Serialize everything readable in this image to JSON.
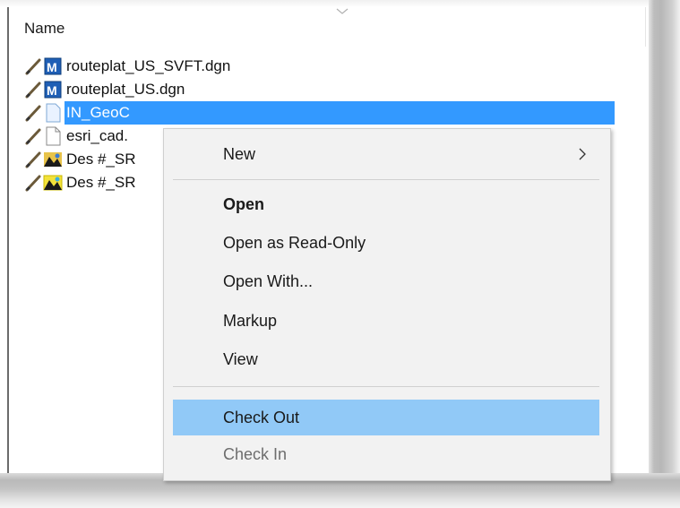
{
  "header": {
    "name_column": "Name"
  },
  "files": [
    {
      "name": "routeplat_US_SVFT.dgn",
      "icon": "microstation-dgn-icon"
    },
    {
      "name": "routeplat_US.dgn",
      "icon": "microstation-dgn-icon"
    },
    {
      "name": "IN_GeoC",
      "icon": "blank-file-icon",
      "selected": true
    },
    {
      "name": "esri_cad.",
      "icon": "document-file-icon"
    },
    {
      "name": "Des #_SR",
      "icon": "geopak-image-icon"
    },
    {
      "name": "Des #_SR",
      "icon": "geopak-image-icon"
    }
  ],
  "context_menu": {
    "items": [
      {
        "label": "New",
        "has_submenu": true
      },
      {
        "label": "Open",
        "bold": true
      },
      {
        "label": "Open as Read-Only"
      },
      {
        "label": "Open With..."
      },
      {
        "label": "Markup"
      },
      {
        "label": "View"
      },
      {
        "label": "Check Out",
        "hover": true
      },
      {
        "label": "Check In",
        "disabled": true
      }
    ]
  },
  "colors": {
    "selection": "#3399ff",
    "menu_hover": "#91c9f7",
    "menu_bg": "#f2f2f2"
  }
}
